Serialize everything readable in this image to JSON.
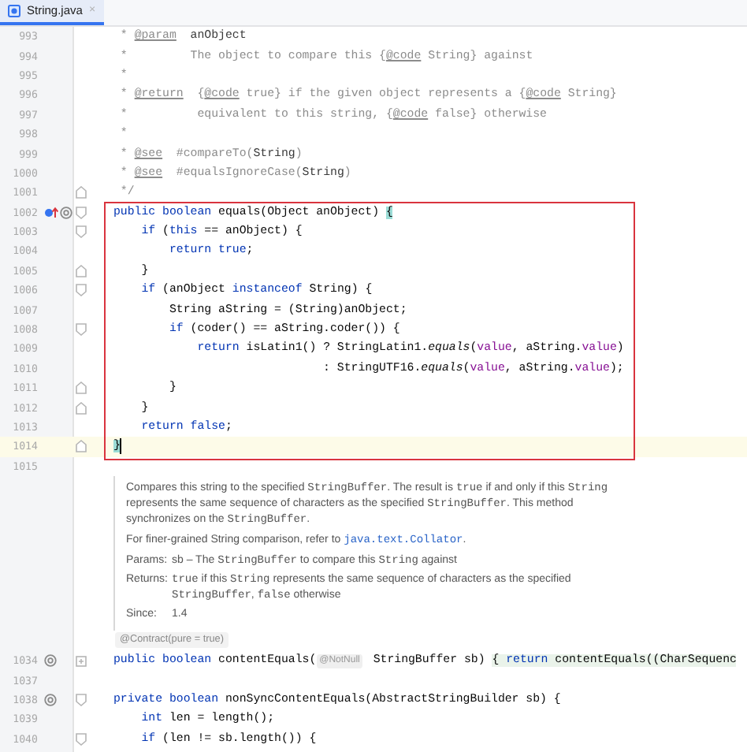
{
  "tab": {
    "label": "String.java",
    "selected": true,
    "close": "×"
  },
  "editor": {
    "lines": [
      {
        "kind": "code",
        "number": "993",
        "tokens": [
          {
            "kind": "cm",
            "text": " * "
          },
          {
            "kind": "tg",
            "text": "@param"
          },
          {
            "kind": "cd",
            "text": "  anObject"
          }
        ]
      },
      {
        "kind": "code",
        "number": "994",
        "tokens": [
          {
            "kind": "cm",
            "text": " *         The object to compare this {"
          },
          {
            "kind": "tg",
            "text": "@code"
          },
          {
            "kind": "cm",
            "text": " String} against"
          }
        ]
      },
      {
        "kind": "code",
        "number": "995",
        "tokens": [
          {
            "kind": "cm",
            "text": " *"
          }
        ]
      },
      {
        "kind": "code",
        "number": "996",
        "tokens": [
          {
            "kind": "cm",
            "text": " * "
          },
          {
            "kind": "tg",
            "text": "@return"
          },
          {
            "kind": "cm",
            "text": "  {"
          },
          {
            "kind": "tg",
            "text": "@code"
          },
          {
            "kind": "cm",
            "text": " true} if the given object represents a {"
          },
          {
            "kind": "tg",
            "text": "@code"
          },
          {
            "kind": "cm",
            "text": " String}"
          }
        ]
      },
      {
        "kind": "code",
        "number": "997",
        "tokens": [
          {
            "kind": "cm",
            "text": " *          equivalent to this string, {"
          },
          {
            "kind": "tg",
            "text": "@code"
          },
          {
            "kind": "cm",
            "text": " false} otherwise"
          }
        ]
      },
      {
        "kind": "code",
        "number": "998",
        "tokens": [
          {
            "kind": "cm",
            "text": " *"
          }
        ]
      },
      {
        "kind": "code",
        "number": "999",
        "tokens": [
          {
            "kind": "cm",
            "text": " * "
          },
          {
            "kind": "tg",
            "text": "@see"
          },
          {
            "kind": "cm",
            "text": "  #compareTo("
          },
          {
            "kind": "cd",
            "text": "String"
          },
          {
            "kind": "cm",
            "text": ")"
          }
        ]
      },
      {
        "kind": "code",
        "number": "1000",
        "tokens": [
          {
            "kind": "cm",
            "text": " * "
          },
          {
            "kind": "tg",
            "text": "@see"
          },
          {
            "kind": "cm",
            "text": "  #equalsIgnoreCase("
          },
          {
            "kind": "cd",
            "text": "String"
          },
          {
            "kind": "cm",
            "text": ")"
          }
        ]
      },
      {
        "kind": "code",
        "number": "1001",
        "fold": {
          "kind": "end"
        },
        "tokens": [
          {
            "kind": "cm",
            "text": " */"
          }
        ]
      },
      {
        "kind": "highlight_box",
        "lines": [
          {
            "kind": "code",
            "number": "1002",
            "gutter": [
              {
                "kind": "override"
              },
              {
                "kind": "annotation"
              }
            ],
            "fold": {
              "kind": "start"
            },
            "tokens": [
              {
                "kind": "kw",
                "text": "public boolean "
              },
              {
                "kind": "p",
                "text": "equals(Object anObject) "
              },
              {
                "kind": "br",
                "text": "{"
              }
            ]
          },
          {
            "kind": "code",
            "number": "1003",
            "fold": {
              "kind": "start"
            },
            "tokens": [
              {
                "kind": "kw",
                "text": "    if"
              },
              {
                "kind": "p",
                "text": " ("
              },
              {
                "kind": "kw",
                "text": "this"
              },
              {
                "kind": "p",
                "text": " == anObject) {"
              }
            ]
          },
          {
            "kind": "code",
            "number": "1004",
            "tokens": [
              {
                "kind": "kw",
                "text": "        return true"
              },
              {
                "kind": "p",
                "text": ";"
              }
            ]
          },
          {
            "kind": "code",
            "number": "1005",
            "fold": {
              "kind": "end"
            },
            "tokens": [
              {
                "kind": "p",
                "text": "    }"
              }
            ]
          },
          {
            "kind": "code",
            "number": "1006",
            "fold": {
              "kind": "start"
            },
            "tokens": [
              {
                "kind": "kw",
                "text": "    if"
              },
              {
                "kind": "p",
                "text": " (anObject "
              },
              {
                "kind": "kw",
                "text": "instanceof"
              },
              {
                "kind": "p",
                "text": " String) {"
              }
            ]
          },
          {
            "kind": "code",
            "number": "1007",
            "tokens": [
              {
                "kind": "p",
                "text": "        String aString = (String)anObject;"
              }
            ]
          },
          {
            "kind": "code",
            "number": "1008",
            "fold": {
              "kind": "start"
            },
            "tokens": [
              {
                "kind": "kw",
                "text": "        if"
              },
              {
                "kind": "p",
                "text": " (coder() == aString.coder()) {"
              }
            ]
          },
          {
            "kind": "code",
            "number": "1009",
            "tokens": [
              {
                "kind": "kw",
                "text": "            return"
              },
              {
                "kind": "p",
                "text": " isLatin1() ? StringLatin1."
              },
              {
                "kind": "st",
                "text": "equals"
              },
              {
                "kind": "p",
                "text": "("
              },
              {
                "kind": "fd",
                "text": "value"
              },
              {
                "kind": "p",
                "text": ", aString."
              },
              {
                "kind": "fd",
                "text": "value"
              },
              {
                "kind": "p",
                "text": ")"
              }
            ]
          },
          {
            "kind": "code",
            "number": "1010",
            "tokens": [
              {
                "kind": "p",
                "text": "                              : StringUTF16."
              },
              {
                "kind": "st",
                "text": "equals"
              },
              {
                "kind": "p",
                "text": "("
              },
              {
                "kind": "fd",
                "text": "value"
              },
              {
                "kind": "p",
                "text": ", aString."
              },
              {
                "kind": "fd",
                "text": "value"
              },
              {
                "kind": "p",
                "text": ");"
              }
            ]
          },
          {
            "kind": "code",
            "number": "1011",
            "fold": {
              "kind": "end"
            },
            "tokens": [
              {
                "kind": "p",
                "text": "        }"
              }
            ]
          },
          {
            "kind": "code",
            "number": "1012",
            "fold": {
              "kind": "end"
            },
            "tokens": [
              {
                "kind": "p",
                "text": "    }"
              }
            ]
          },
          {
            "kind": "code",
            "number": "1013",
            "tokens": [
              {
                "kind": "kw",
                "text": "    return false"
              },
              {
                "kind": "p",
                "text": ";"
              }
            ]
          },
          {
            "kind": "code",
            "number": "1014",
            "current": true,
            "fold": {
              "kind": "end"
            },
            "tokens": [
              {
                "kind": "br",
                "text": "}"
              }
            ]
          }
        ]
      },
      {
        "kind": "code",
        "number": "1015"
      },
      {
        "kind": "doc",
        "paragraphs": [
          [
            {
              "kind": "t",
              "text": "Compares this string to the specified "
            },
            {
              "kind": "c",
              "text": "StringBuffer"
            },
            {
              "kind": "t",
              "text": ". The result is "
            },
            {
              "kind": "c",
              "text": "true"
            },
            {
              "kind": "t",
              "text": " if and only if this "
            },
            {
              "kind": "c",
              "text": "String"
            },
            {
              "kind": "t",
              "text": " represents the same sequence of characters as the specified "
            },
            {
              "kind": "c",
              "text": "StringBuffer"
            },
            {
              "kind": "t",
              "text": ". This method synchronizes on the "
            },
            {
              "kind": "c",
              "text": "StringBuffer"
            },
            {
              "kind": "t",
              "text": "."
            }
          ],
          [
            {
              "kind": "t",
              "text": "For finer-grained String comparison, refer to "
            },
            {
              "kind": "a",
              "text": "java.text.Collator"
            },
            {
              "kind": "t",
              "text": "."
            }
          ]
        ],
        "fields": [
          {
            "label": "Params:",
            "value": [
              {
                "kind": "t",
                "text": "sb – The "
              },
              {
                "kind": "c",
                "text": "StringBuffer"
              },
              {
                "kind": "t",
                "text": " to compare this "
              },
              {
                "kind": "c",
                "text": "String"
              },
              {
                "kind": "t",
                "text": " against"
              }
            ]
          },
          {
            "label": "Returns:",
            "value": [
              {
                "kind": "c",
                "text": "true"
              },
              {
                "kind": "t",
                "text": " if this "
              },
              {
                "kind": "c",
                "text": "String"
              },
              {
                "kind": "t",
                "text": " represents the same sequence of characters as the specified "
              },
              {
                "kind": "c",
                "text": "StringBuffer"
              },
              {
                "kind": "t",
                "text": ", "
              },
              {
                "kind": "c",
                "text": "false"
              },
              {
                "kind": "t",
                "text": " otherwise"
              }
            ]
          },
          {
            "label": "Since:",
            "value": [
              {
                "kind": "t",
                "text": "1.4"
              }
            ]
          }
        ]
      },
      {
        "kind": "inlay",
        "text": "@Contract(pure = true)"
      },
      {
        "kind": "code",
        "number": "1034",
        "gutter": [
          {
            "kind": "annotation"
          }
        ],
        "fold": {
          "kind": "folded"
        },
        "tokens": [
          {
            "kind": "kw",
            "text": "public boolean "
          },
          {
            "kind": "p",
            "text": "contentEquals("
          },
          {
            "kind": "ht",
            "text": "@NotNull"
          },
          {
            "kind": "p",
            "text": " StringBuffer sb) "
          },
          {
            "kind": "fl",
            "text": "{ "
          },
          {
            "kind": "fk",
            "text": "return"
          },
          {
            "kind": "fl",
            "text": " contentEquals((CharSequenc"
          }
        ]
      },
      {
        "kind": "code",
        "number": "1037"
      },
      {
        "kind": "code",
        "number": "1038",
        "gutter": [
          {
            "kind": "annotation"
          }
        ],
        "fold": {
          "kind": "start"
        },
        "tokens": [
          {
            "kind": "kw",
            "text": "private boolean "
          },
          {
            "kind": "p",
            "text": "nonSyncContentEquals(AbstractStringBuilder sb) {"
          }
        ]
      },
      {
        "kind": "code",
        "number": "1039",
        "tokens": [
          {
            "kind": "kw",
            "text": "    int"
          },
          {
            "kind": "p",
            "text": " len = length();"
          }
        ]
      },
      {
        "kind": "code",
        "number": "1040",
        "fold": {
          "kind": "start"
        },
        "tokens": [
          {
            "kind": "kw",
            "text": "    if"
          },
          {
            "kind": "p",
            "text": " (len != sb.length()) {"
          }
        ]
      }
    ]
  }
}
